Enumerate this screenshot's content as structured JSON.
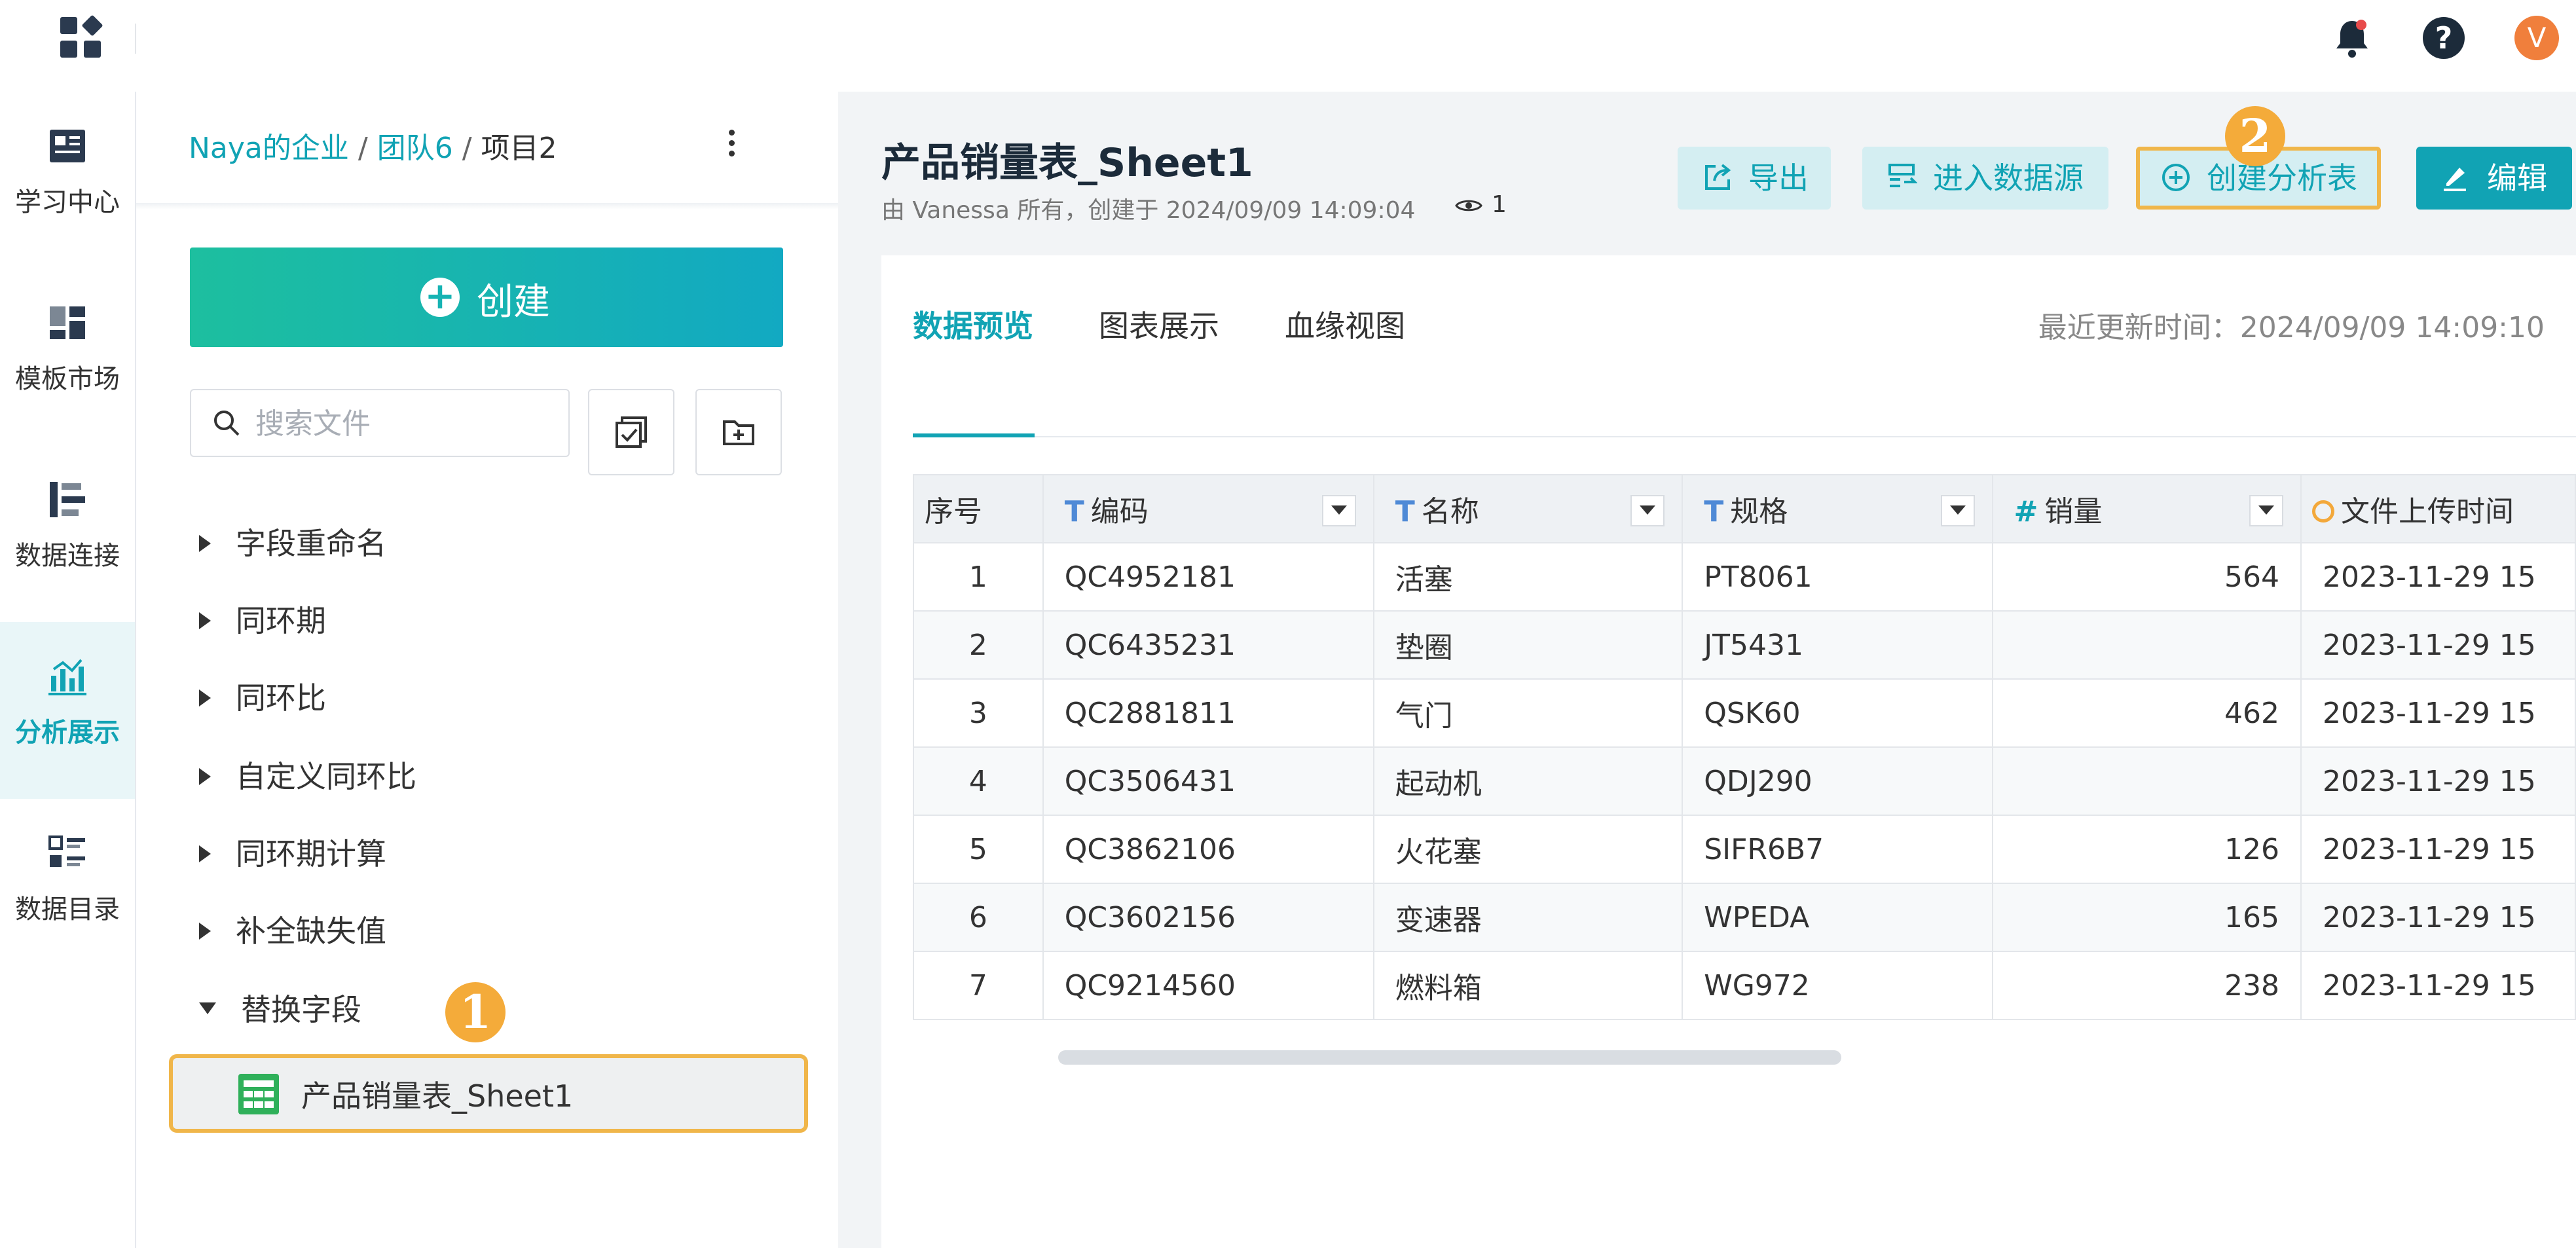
{
  "topbar": {
    "avatar_letter": "V"
  },
  "rail": [
    {
      "label": "学习中心",
      "icon": "learning-center-icon"
    },
    {
      "label": "模板市场",
      "icon": "template-market-icon"
    },
    {
      "label": "数据连接",
      "icon": "data-connection-icon"
    },
    {
      "label": "分析展示",
      "icon": "analysis-display-icon",
      "active": true
    },
    {
      "label": "数据目录",
      "icon": "data-catalog-icon"
    }
  ],
  "panel": {
    "breadcrumb": [
      "Naya的企业",
      "团队6",
      "项目2"
    ],
    "breadcrumb_sep": "/",
    "create_label": "创建",
    "search_placeholder": "搜索文件",
    "tree": [
      {
        "label": "字段重命名",
        "expanded": false
      },
      {
        "label": "同环期",
        "expanded": false
      },
      {
        "label": "同环比",
        "expanded": false
      },
      {
        "label": "自定义同环比",
        "expanded": false
      },
      {
        "label": "同环期计算",
        "expanded": false
      },
      {
        "label": "补全缺失值",
        "expanded": false
      },
      {
        "label": "替换字段",
        "expanded": true
      }
    ],
    "selected_file": "产品销量表_Sheet1",
    "badge_1": "1"
  },
  "main": {
    "title": "产品销量表_Sheet1",
    "subtitle": "由 Vanessa 所有，创建于 2024/09/09 14:09:04",
    "view_count": "1",
    "actions": {
      "export": "导出",
      "enter_datasource": "进入数据源",
      "create_analysis": "创建分析表",
      "edit": "编辑"
    },
    "badge_2": "2",
    "tabs": [
      "数据预览",
      "图表展示",
      "血缘视图"
    ],
    "updated": "最近更新时间：2024/09/09 14:09:10",
    "table": {
      "columns": [
        {
          "type": "",
          "label": "序号"
        },
        {
          "type": "T",
          "label": "编码"
        },
        {
          "type": "T",
          "label": "名称"
        },
        {
          "type": "T",
          "label": "规格"
        },
        {
          "type": "#",
          "label": "销量"
        },
        {
          "type": "clock",
          "label": "文件上传时间"
        }
      ],
      "rows": [
        [
          "1",
          "QC4952181",
          "活塞",
          "PT8061",
          "564",
          "2023-11-29 15"
        ],
        [
          "2",
          "QC6435231",
          "垫圈",
          "JT5431",
          "",
          "2023-11-29 15"
        ],
        [
          "3",
          "QC2881811",
          "气门",
          "QSK60",
          "462",
          "2023-11-29 15"
        ],
        [
          "4",
          "QC3506431",
          "起动机",
          "QDJ290",
          "",
          "2023-11-29 15"
        ],
        [
          "5",
          "QC3862106",
          "火花塞",
          "SIFR6B7",
          "126",
          "2023-11-29 15"
        ],
        [
          "6",
          "QC3602156",
          "变速器",
          "WPEDA",
          "165",
          "2023-11-29 15"
        ],
        [
          "7",
          "QC9214560",
          "燃料箱",
          "WG972",
          "238",
          "2023-11-29 15"
        ]
      ]
    }
  },
  "colors": {
    "accent": "#11a3b4",
    "highlight": "#f0b64a",
    "avatar": "#f07f3c"
  }
}
